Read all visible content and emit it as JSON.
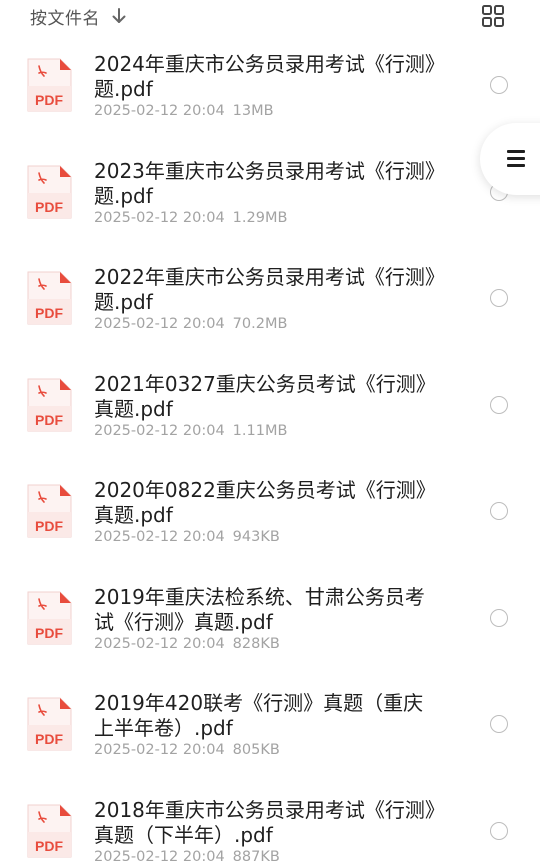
{
  "toolbar": {
    "sort_label": "按文件名",
    "sort_icon": "arrow-down-icon",
    "view_toggle_icon": "grid-view-icon"
  },
  "file_icon_text": "PDF",
  "files": [
    {
      "name": "2024年重庆市公务员录用考试《行测》题.pdf",
      "date": "2025-02-12 20:04",
      "size": "13MB"
    },
    {
      "name": "2023年重庆市公务员录用考试《行测》题.pdf",
      "date": "2025-02-12 20:04",
      "size": "1.29MB"
    },
    {
      "name": "2022年重庆市公务员录用考试《行测》题.pdf",
      "date": "2025-02-12 20:04",
      "size": "70.2MB"
    },
    {
      "name": "2021年0327重庆公务员考试《行测》真题.pdf",
      "date": "2025-02-12 20:04",
      "size": "1.11MB"
    },
    {
      "name": "2020年0822重庆公务员考试《行测》真题.pdf",
      "date": "2025-02-12 20:04",
      "size": "943KB"
    },
    {
      "name": "2019年重庆法检系统、甘肃公务员考试《行测》真题.pdf",
      "date": "2025-02-12 20:04",
      "size": "828KB"
    },
    {
      "name": "2019年420联考《行测》真题（重庆上半年卷）.pdf",
      "date": "2025-02-12 20:04",
      "size": "805KB"
    },
    {
      "name": "2018年重庆市公务员录用考试《行测》真题（下半年）.pdf",
      "date": "2025-02-12 20:04",
      "size": "887KB"
    }
  ],
  "floating_menu_icon": "menu-icon",
  "colors": {
    "pdf_red": "#e84c3d",
    "meta_gray": "#a3a3a3"
  }
}
